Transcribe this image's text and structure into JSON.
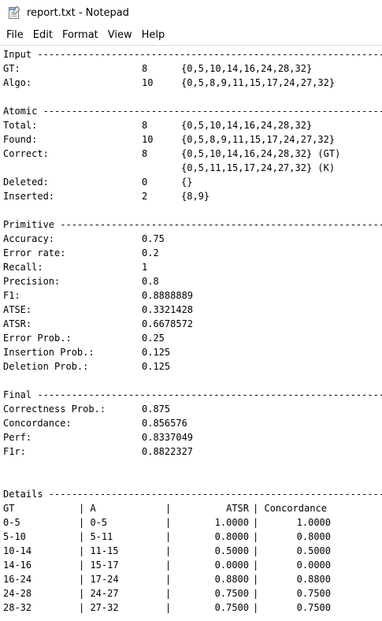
{
  "window": {
    "title": "report.txt - Notepad",
    "icon": "notepad-icon"
  },
  "menu": [
    "File",
    "Edit",
    "Format",
    "View",
    "Help"
  ],
  "editor_lines": [
    {
      "row": 0,
      "cols": [
        "Input -------------------------------------------------------------"
      ]
    },
    {
      "row": 1,
      "cols": [
        "GT:",
        "8",
        "{0,5,10,14,16,24,28,32}"
      ]
    },
    {
      "row": 2,
      "cols": [
        "Algo:",
        "10",
        "{0,5,8,9,11,15,17,24,27,32}"
      ]
    },
    {
      "row": 4,
      "cols": [
        "Atomic ------------------------------------------------------------"
      ]
    },
    {
      "row": 5,
      "cols": [
        "Total:",
        "8",
        "{0,5,10,14,16,24,28,32}"
      ]
    },
    {
      "row": 6,
      "cols": [
        "Found:",
        "10",
        "{0,5,8,9,11,15,17,24,27,32}"
      ]
    },
    {
      "row": 7,
      "cols": [
        "Correct:",
        "8",
        "{0,5,10,14,16,24,28,32} (GT)"
      ]
    },
    {
      "row": 8,
      "cols": [
        "",
        "",
        "{0,5,11,15,17,24,27,32} (K)"
      ]
    },
    {
      "row": 9,
      "cols": [
        "Deleted:",
        "0",
        "{}"
      ]
    },
    {
      "row": 10,
      "cols": [
        "Inserted:",
        "2",
        "{8,9}"
      ]
    },
    {
      "row": 12,
      "cols": [
        "Primitive ---------------------------------------------------------"
      ]
    },
    {
      "row": 13,
      "cols": [
        "Accuracy:",
        "0.75"
      ]
    },
    {
      "row": 14,
      "cols": [
        "Error rate:",
        "0.2"
      ]
    },
    {
      "row": 15,
      "cols": [
        "Recall:",
        "1"
      ]
    },
    {
      "row": 16,
      "cols": [
        "Precision:",
        "0.8"
      ]
    },
    {
      "row": 17,
      "cols": [
        "F1:",
        "0.8888889"
      ]
    },
    {
      "row": 18,
      "cols": [
        "ATSE:",
        "0.3321428"
      ]
    },
    {
      "row": 19,
      "cols": [
        "ATSR:",
        "0.6678572"
      ]
    },
    {
      "row": 20,
      "cols": [
        "Error Prob.:",
        "0.25"
      ]
    },
    {
      "row": 21,
      "cols": [
        "Insertion Prob.:",
        "0.125"
      ]
    },
    {
      "row": 22,
      "cols": [
        "Deletion Prob.:",
        "0.125"
      ]
    },
    {
      "row": 24,
      "cols": [
        "Final -------------------------------------------------------------"
      ]
    },
    {
      "row": 25,
      "cols": [
        "Correctness Prob.:",
        "0.875"
      ]
    },
    {
      "row": 26,
      "cols": [
        "Concordance:",
        "0.856576"
      ]
    },
    {
      "row": 27,
      "cols": [
        "Perf:",
        "0.8337049"
      ]
    },
    {
      "row": 28,
      "cols": [
        "F1r:",
        "0.8822327"
      ]
    },
    {
      "row": 31,
      "cols": [
        "Details -----------------------------------------------------------"
      ]
    },
    {
      "row": 32,
      "cols": [
        "GT",
        "| A",
        "|",
        "ATSR",
        "| Concordance"
      ]
    },
    {
      "row": 33,
      "cols": [
        "0-5",
        "| 0-5",
        "|",
        "1.0000",
        "|",
        "1.0000"
      ]
    },
    {
      "row": 34,
      "cols": [
        "5-10",
        "| 5-11",
        "|",
        "0.8000",
        "|",
        "0.8000"
      ]
    },
    {
      "row": 35,
      "cols": [
        "10-14",
        "| 11-15",
        "|",
        "0.5000",
        "|",
        "0.5000"
      ]
    },
    {
      "row": 36,
      "cols": [
        "14-16",
        "| 15-17",
        "|",
        "0.0000",
        "|",
        "0.0000"
      ]
    },
    {
      "row": 37,
      "cols": [
        "16-24",
        "| 17-24",
        "|",
        "0.8800",
        "|",
        "0.8800"
      ]
    },
    {
      "row": 38,
      "cols": [
        "24-28",
        "| 24-27",
        "|",
        "0.7500",
        "|",
        "0.7500"
      ]
    },
    {
      "row": 39,
      "cols": [
        "28-32",
        "| 27-32",
        "|",
        "0.7500",
        "|",
        "0.7500"
      ]
    }
  ]
}
